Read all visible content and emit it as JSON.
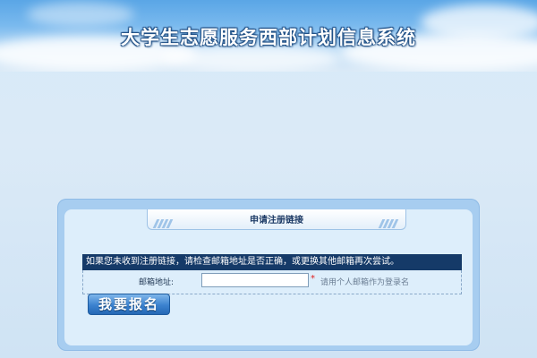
{
  "header": {
    "title": "大学生志愿服务西部计划信息系统"
  },
  "panel": {
    "tab_label": "申请注册链接",
    "notice": "如果您未收到注册链接，请检查邮箱地址是否正确，或更换其他邮箱再次尝试。",
    "email_label": "邮箱地址:",
    "email_value": "",
    "required_mark": "*",
    "email_hint": "请用个人邮箱作为登录名",
    "submit_label": "我要报名"
  },
  "colors": {
    "notice_bg": "#153a68",
    "button": "#3b82cf",
    "required": "#e02020"
  }
}
